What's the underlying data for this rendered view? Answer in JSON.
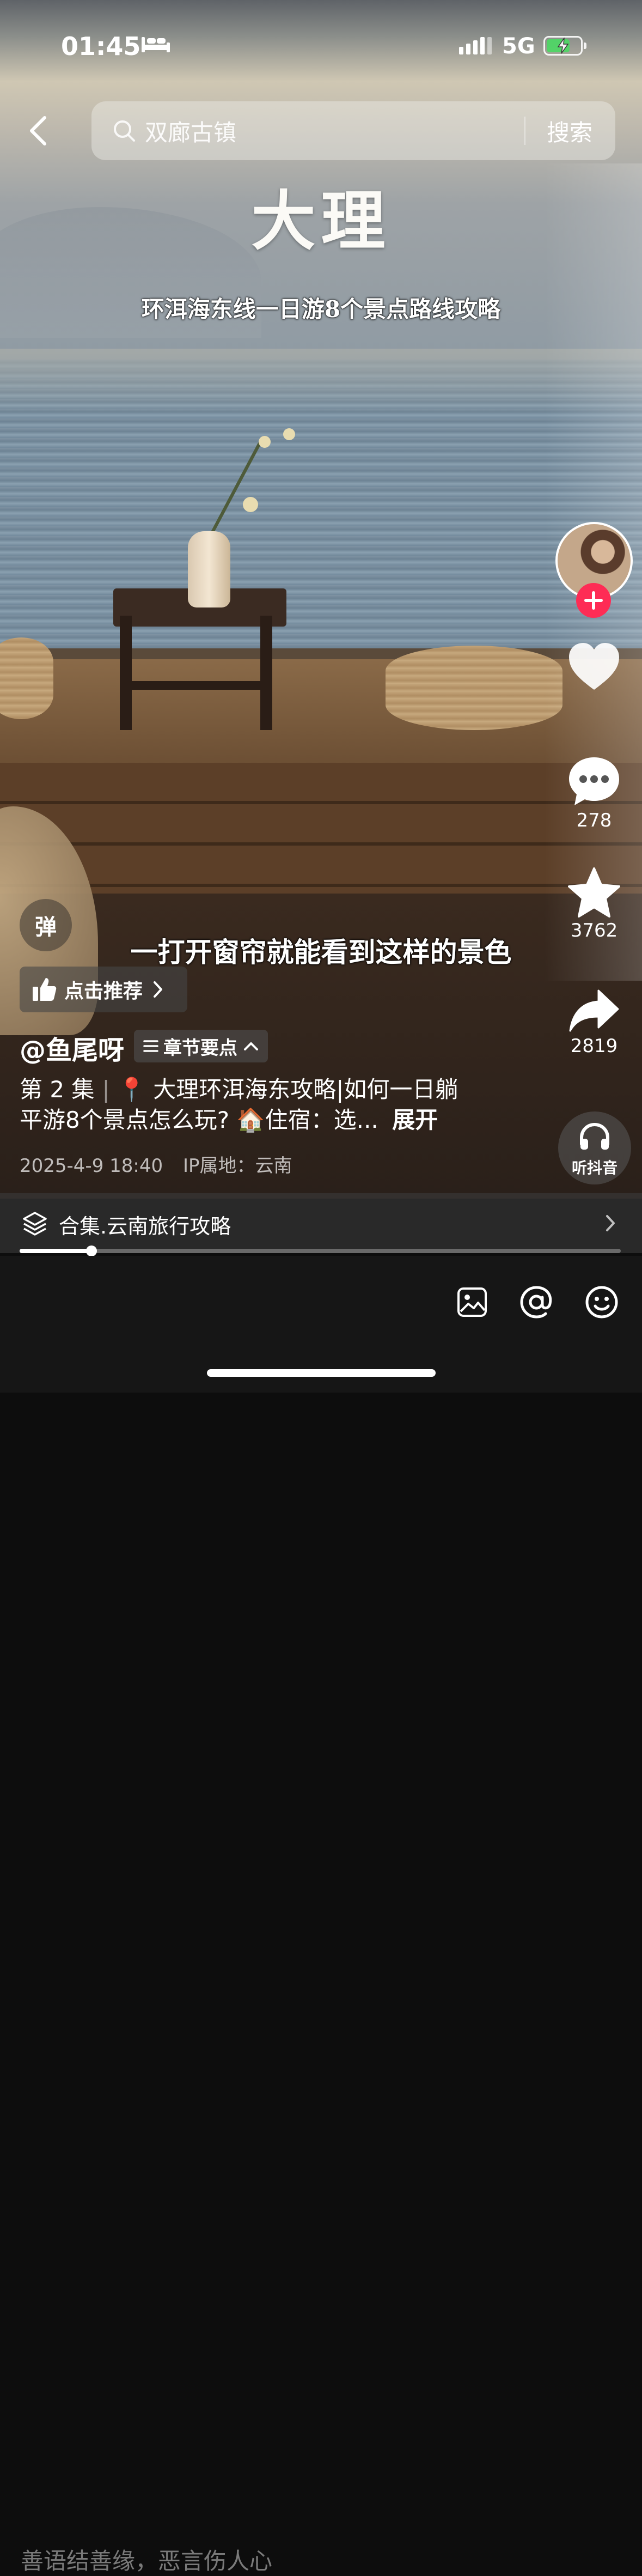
{
  "status_bar": {
    "time": "01:45",
    "network": "5G",
    "battery_level": 0.7,
    "icons": [
      "bed-icon",
      "signal-icon",
      "battery-charging-icon"
    ]
  },
  "search": {
    "placeholder": "双廊古镇",
    "button_label": "搜索"
  },
  "video": {
    "title": "大理",
    "subtitle": "环洱海东线一日游8个景点路线攻略",
    "caption": "一打开窗帘就能看到这样的景色"
  },
  "actions": {
    "comment_count": "278",
    "favorite_count": "3762",
    "share_count": "2819",
    "listen_label": "听抖音"
  },
  "danmaku_label": "弹",
  "recommend_label": "点击推荐",
  "author": "@鱼尾呀",
  "chapter_label": "章节要点",
  "description": {
    "episode": "第 2 集",
    "text_line1": "📍 大理环洱海东攻略|如何一日躺",
    "text_line2": "平游8个景点怎么玩? 🏠住宿：选...",
    "expand": "展开"
  },
  "meta": {
    "datetime": "2025-4-9 18:40",
    "ip_location": "IP属地：云南"
  },
  "collection": {
    "label": "合集.云南旅行攻略",
    "progress": 0.12
  },
  "comment_bar": {
    "placeholder": "善语结善缘，恶言伤人心"
  },
  "colors": {
    "accent_red": "#fe2c55",
    "battery_green": "#4cd964"
  }
}
